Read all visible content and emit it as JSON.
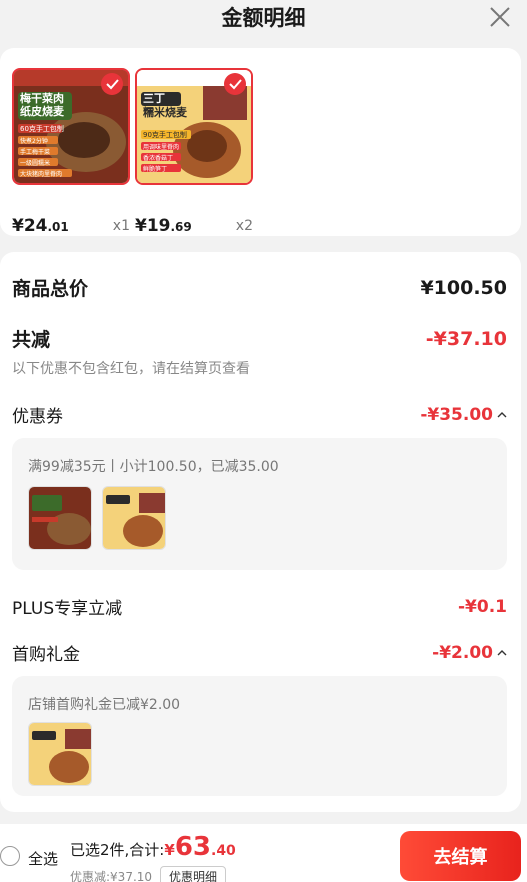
{
  "header": {
    "title": "金额明细"
  },
  "products": [
    {
      "name_lines": [
        "梅干菜肉",
        "纸皮烧麦"
      ],
      "promo": "60克手工包制",
      "tags": [
        "快煮2分钟",
        "手工梅干菜",
        "一级圆糯米",
        "大块猪肉里脊肉"
      ],
      "price_int": "¥24",
      "price_dec": ".01",
      "qty": "x1"
    },
    {
      "name_lines": [
        "三丁",
        "糯米烧麦"
      ],
      "promo": "90克手工包制",
      "tags": [
        "用调味里脊肉",
        "香浓香菇丁",
        "鲜脆笋丁"
      ],
      "price_int": "¥19",
      "price_dec": ".69",
      "qty": "x2"
    }
  ],
  "detail": {
    "total_label": "商品总价",
    "total_value": "¥100.50",
    "reduce_label": "共减",
    "reduce_value": "-¥37.10",
    "reduce_note": "以下优惠不包含红包，请在结算页查看",
    "coupon_label": "优惠券",
    "coupon_value": "-¥35.00",
    "coupon_desc": "满99减35元丨小计100.50，已减35.00",
    "plus_label": "PLUS专享立减",
    "plus_value": "-¥0.1",
    "gift_label": "首购礼金",
    "gift_value": "-¥2.00",
    "gift_desc": "店铺首购礼金已减¥2.00"
  },
  "bottom": {
    "select_all": "全选",
    "selected_text": "已选2件,合计:",
    "total_symbol": "¥",
    "total_int": "63",
    "total_dec": ".40",
    "discount_text": "优惠减:¥37.10",
    "detail_button": "优惠明细",
    "checkout_button": "去结算"
  },
  "colors": {
    "accent": "#e8343a",
    "background": "#f2f2f2"
  }
}
